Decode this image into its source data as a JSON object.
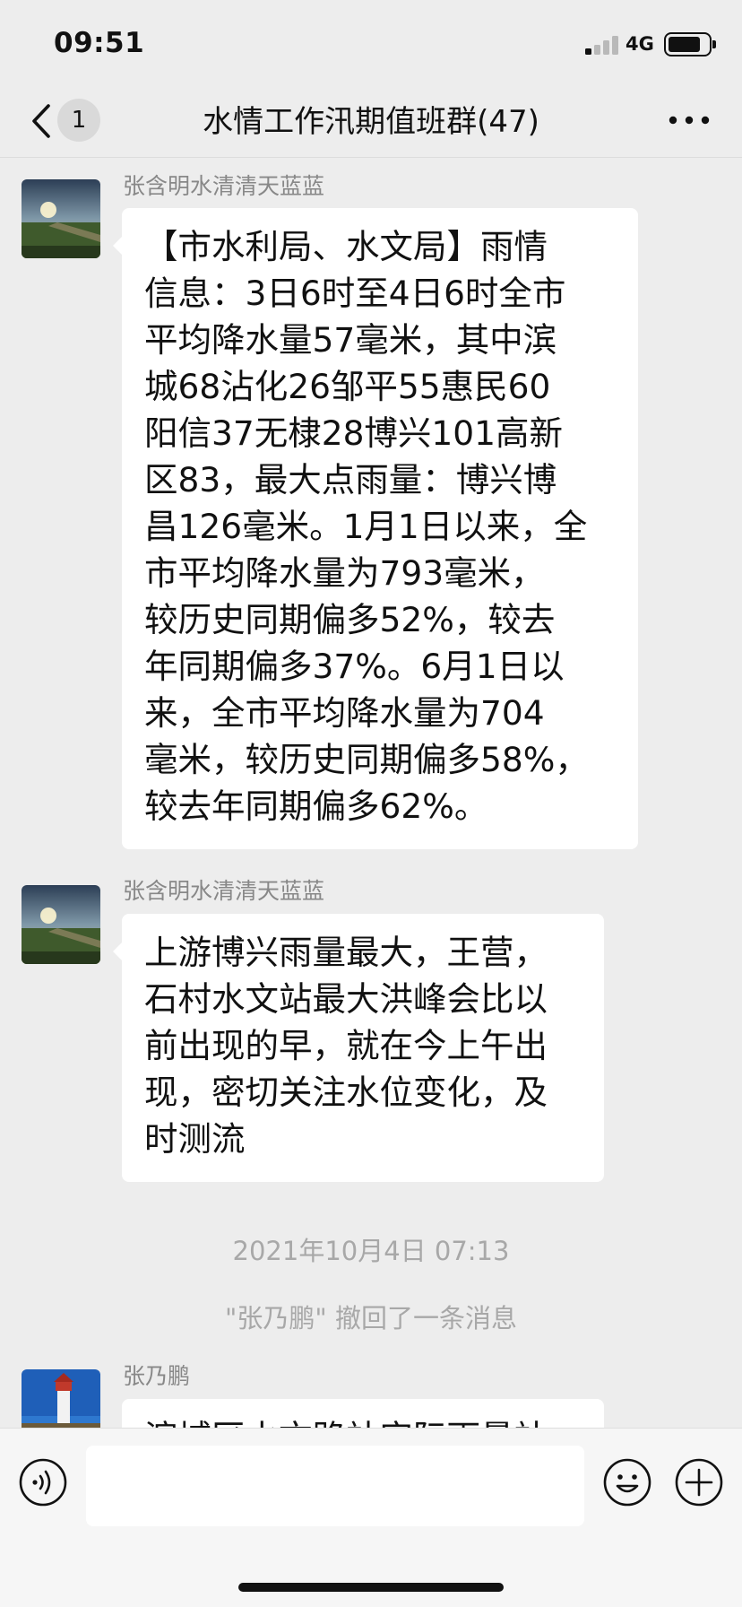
{
  "status_bar": {
    "time": "09:51",
    "network": "4G",
    "icons": [
      "signal-icon",
      "battery-icon"
    ]
  },
  "nav": {
    "unread_count": "1",
    "title": "水情工作汛期值班群(47)",
    "icons": [
      "back-icon",
      "more-icon"
    ]
  },
  "messages": [
    {
      "sender": "张含明水清清天蓝蓝",
      "lines": [
        "【市水利局、水文局】雨情",
        "信息：3日6时至4日6时全市",
        "平均降水量57毫米，其中滨",
        "城68沾化26邹平55惠民60",
        "阳信37无棣28博兴101高新",
        "区83，最大点雨量：博兴博",
        "昌126毫米。1月1日以来，全",
        "市平均降水量为793毫米，",
        "较历史同期偏多52%，较去",
        "年同期偏多37%。6月1日以",
        "来，全市平均降水量为704",
        "毫米，较历史同期偏多58%，",
        "较去年同期偏多62%。"
      ]
    },
    {
      "sender": "张含明水清清天蓝蓝",
      "lines": [
        "上游博兴雨量最大，王营，",
        "石村水文站最大洪峰会比以",
        "前出现的早，就在今上午出",
        "现，密切关注水位变化，及",
        "时测流"
      ]
    },
    {
      "sender": "张乃鹏",
      "lines": [
        "滨城区水文路站实际雨量站"
      ]
    }
  ],
  "timestamp": "2021年10月4日 07:13",
  "system_notice": "\"张乃鹏\" 撤回了一条消息",
  "input_bar": {
    "input_value": "",
    "icons": [
      "voice-icon",
      "emoji-icon",
      "plus-icon"
    ]
  },
  "colors": {
    "background": "#ededed",
    "bubble": "#ffffff",
    "meta_text": "#a8a8a8"
  }
}
